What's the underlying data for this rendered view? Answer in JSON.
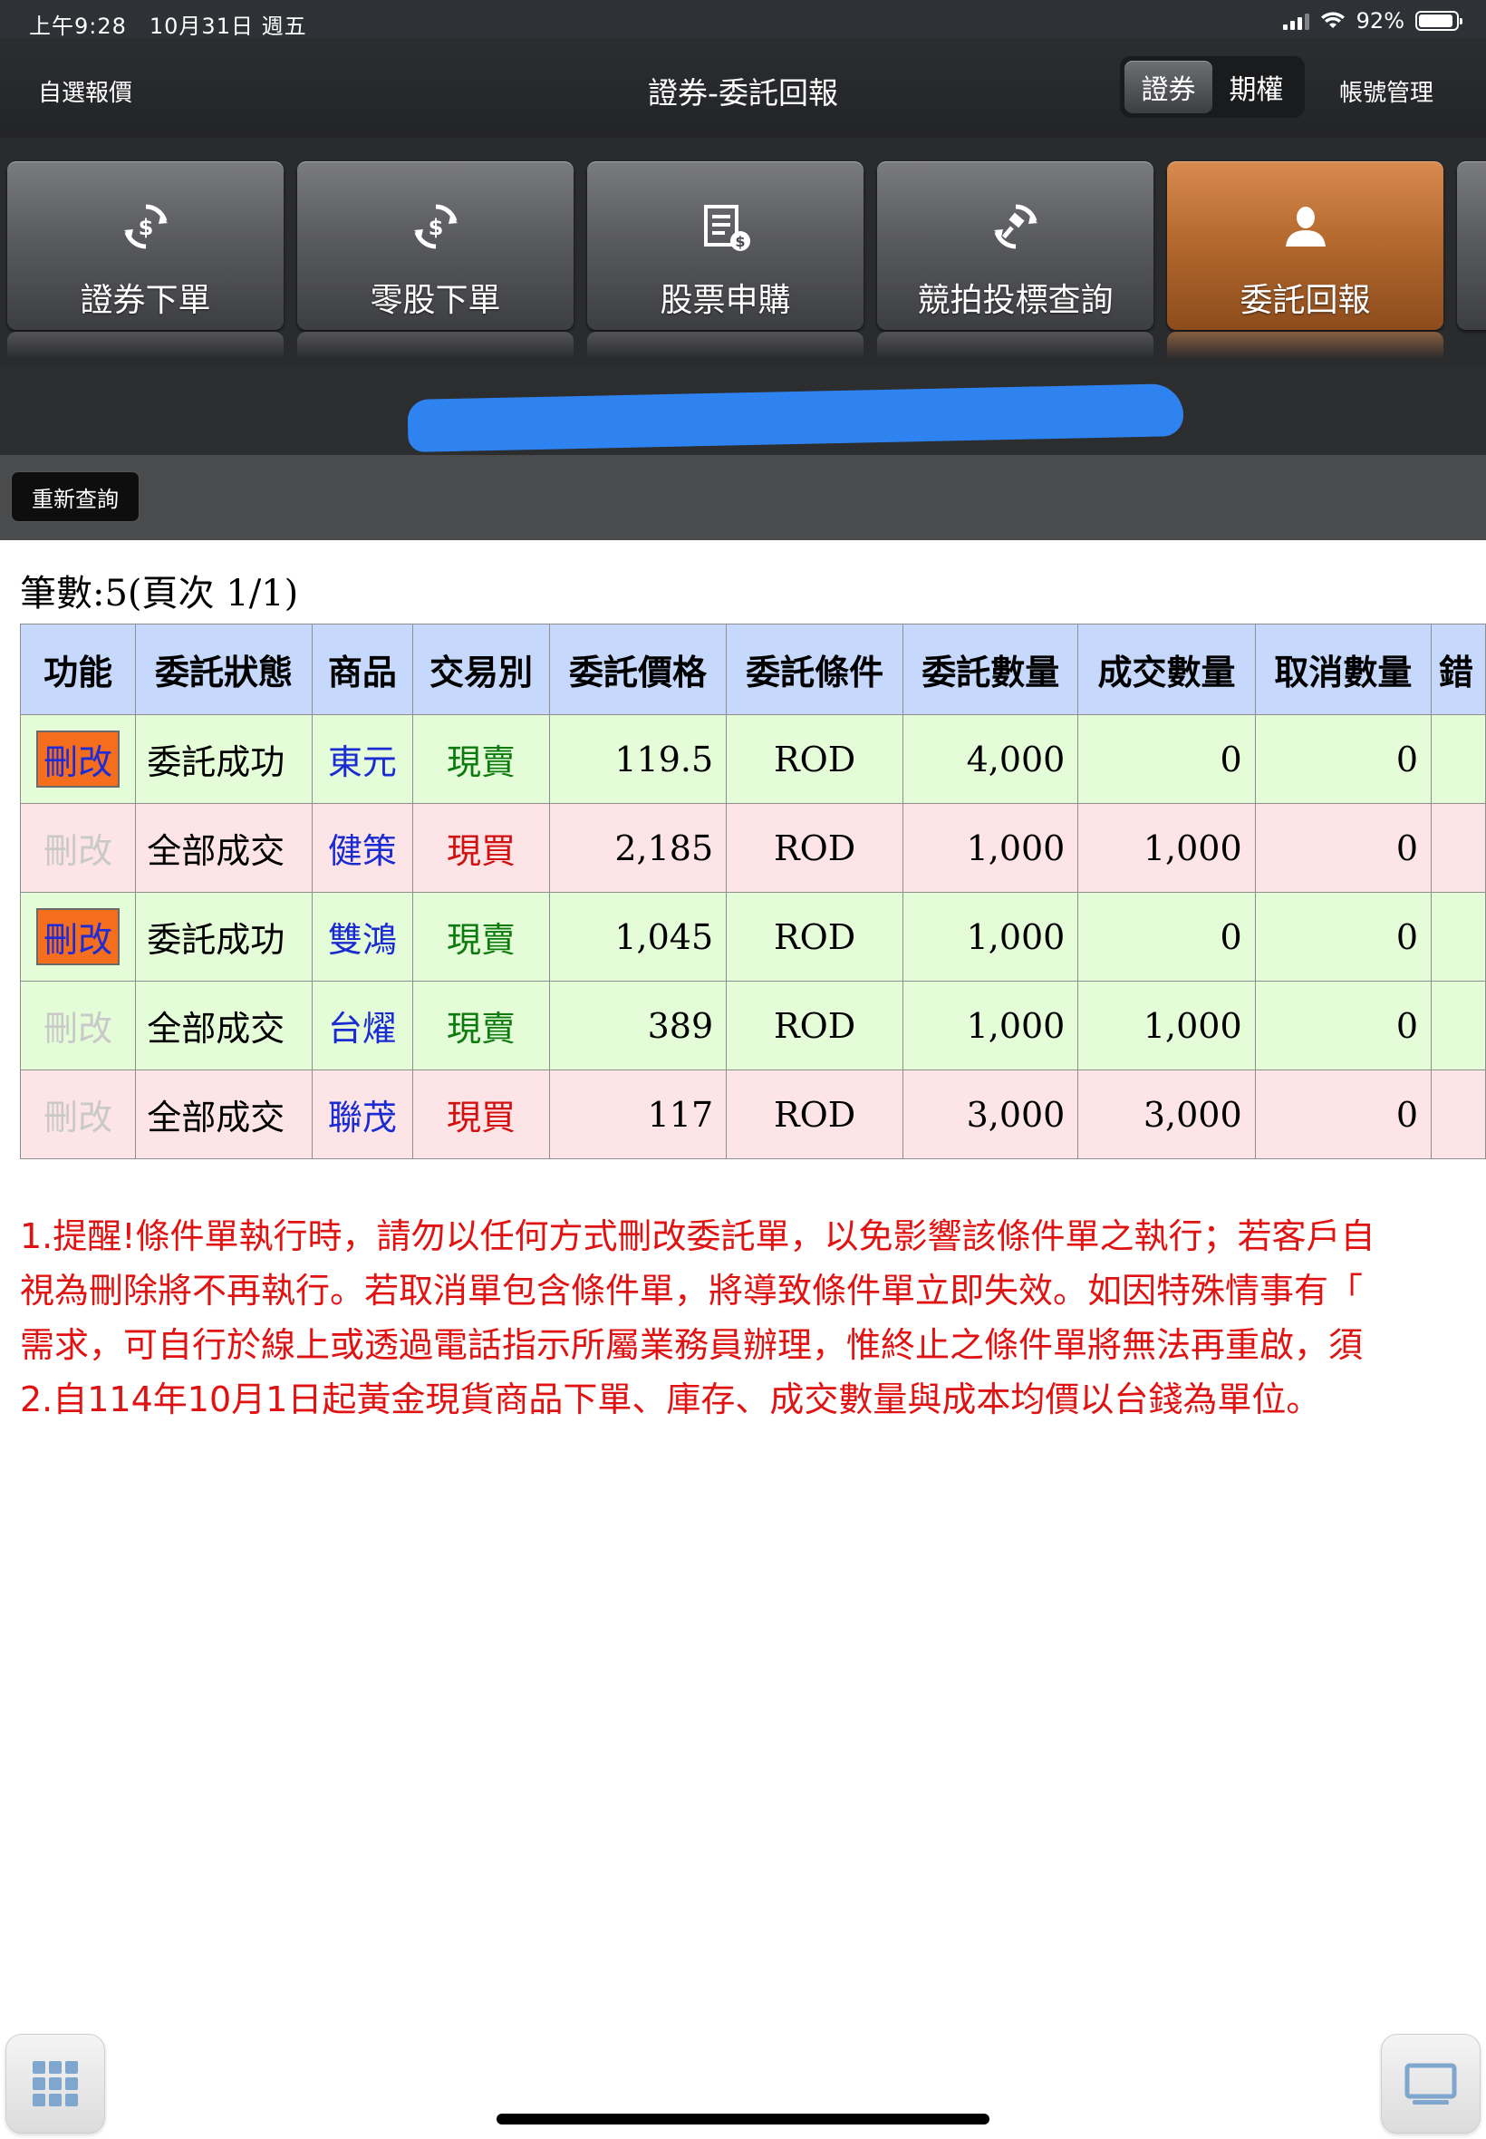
{
  "status_bar": {
    "time_date": "上午9:28　10月31日 週五",
    "battery": "92%",
    "battery_level": 0.92
  },
  "nav": {
    "left": "自選報價",
    "title": "證券-委託回報",
    "segments": [
      "證券",
      "期權"
    ],
    "active_segment": "證券",
    "right": "帳號管理"
  },
  "tiles": [
    {
      "label": "證券下單",
      "icon": "dollar-refresh-icon",
      "active": false
    },
    {
      "label": "零股下單",
      "icon": "dollar-refresh-icon",
      "active": false
    },
    {
      "label": "股票申購",
      "icon": "document-dollar-icon",
      "active": false
    },
    {
      "label": "競拍投標查詢",
      "icon": "gavel-refresh-icon",
      "active": false
    },
    {
      "label": "委託回報",
      "icon": "person-icon",
      "active": true
    }
  ],
  "toolbar": {
    "requery_label": "重新查詢"
  },
  "summary": {
    "count_text": "筆數:5(頁次 1/1)"
  },
  "table": {
    "headers": [
      "功能",
      "委託狀態",
      "商品",
      "交易別",
      "委託價格",
      "委託條件",
      "委託數量",
      "成交數量",
      "取消數量",
      "錯"
    ],
    "rows": [
      {
        "action": "刪改",
        "action_enabled": true,
        "status": "委託成功",
        "product": "東元",
        "side": "現賣",
        "price": "119.5",
        "condition": "ROD",
        "qty": "4,000",
        "filled": "0",
        "cancelled": "0"
      },
      {
        "action": "刪改",
        "action_enabled": false,
        "status": "全部成交",
        "product": "健策",
        "side": "現買",
        "price": "2,185",
        "condition": "ROD",
        "qty": "1,000",
        "filled": "1,000",
        "cancelled": "0"
      },
      {
        "action": "刪改",
        "action_enabled": true,
        "status": "委託成功",
        "product": "雙鴻",
        "side": "現賣",
        "price": "1,045",
        "condition": "ROD",
        "qty": "1,000",
        "filled": "0",
        "cancelled": "0"
      },
      {
        "action": "刪改",
        "action_enabled": false,
        "status": "全部成交",
        "product": "台燿",
        "side": "現賣",
        "price": "389",
        "condition": "ROD",
        "qty": "1,000",
        "filled": "1,000",
        "cancelled": "0"
      },
      {
        "action": "刪改",
        "action_enabled": false,
        "status": "全部成交",
        "product": "聯茂",
        "side": "現買",
        "price": "117",
        "condition": "ROD",
        "qty": "3,000",
        "filled": "3,000",
        "cancelled": "0"
      }
    ]
  },
  "notes": [
    "1.提醒!條件單執行時，請勿以任何方式刪改委託單，以免影響該條件單之執行；若客戶自",
    "視為刪除將不再執行。若取消單包含條件單，將導致條件單立即失效。如因特殊情事有「",
    "需求，可自行於線上或透過電話指示所屬業務員辦理，惟終止之條件單將無法再重啟，須",
    "2.自114年10月1日起黃金現貨商品下單、庫存、成交數量與成本均價以台錢為單位。"
  ],
  "colors": {
    "header_bg": "#c6d8fb",
    "sell_row_bg": "#e4fcd8",
    "buy_row_bg": "#fde4e6",
    "edit_button_bg": "#f56e1e",
    "product_text": "#1a2bd2",
    "sell_text": "#0d7a0d",
    "buy_text": "#d21010",
    "notes_text": "#e01212",
    "active_tile": "#b56a2f"
  }
}
